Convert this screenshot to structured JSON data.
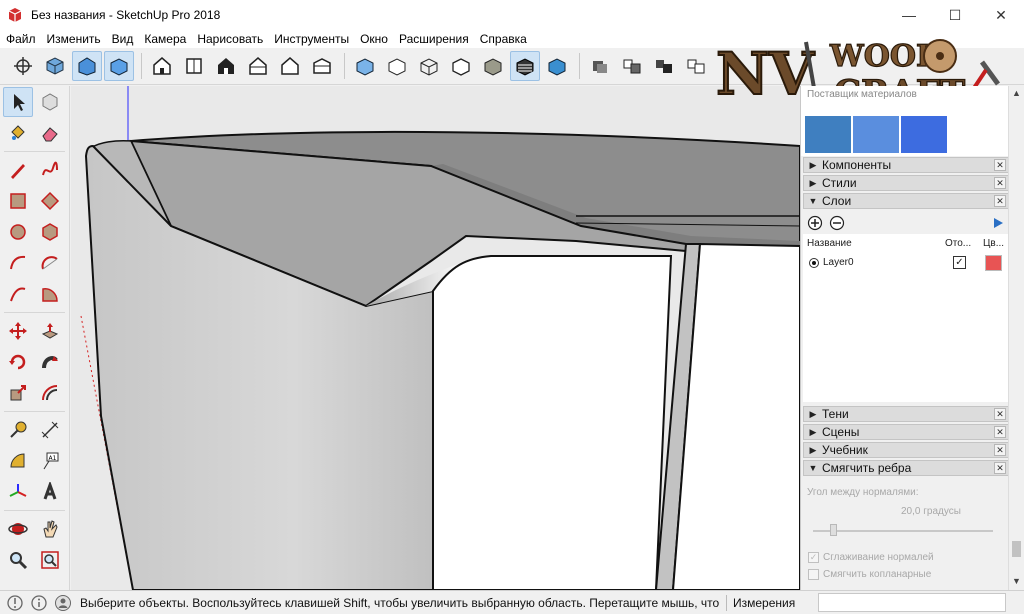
{
  "window": {
    "title": "Без названия - SketchUp Pro 2018",
    "minimize_glyph": "—",
    "maximize_glyph": "☐",
    "close_glyph": "✕"
  },
  "menu": [
    "Файл",
    "Изменить",
    "Вид",
    "Камера",
    "Нарисовать",
    "Инструменты",
    "Окно",
    "Расширения",
    "Справка"
  ],
  "logo": {
    "text": "NV WOOD CRAFT"
  },
  "tray": {
    "materials_title": "Поставщик материалов",
    "swatch_colors": [
      "#3f7fc0",
      "#5a8ede",
      "#3d6ce0"
    ],
    "panels_top": [
      {
        "label": "Компоненты",
        "expanded": false
      },
      {
        "label": "Стили",
        "expanded": false
      },
      {
        "label": "Слои",
        "expanded": true
      }
    ],
    "layers": {
      "col_name": "Название",
      "col_visible": "Ото...",
      "col_color": "Цв...",
      "rows": [
        {
          "name": "Layer0",
          "active": true,
          "visible": true,
          "color": "#e85454"
        }
      ]
    },
    "panels_bottom": [
      {
        "label": "Тени",
        "expanded": false
      },
      {
        "label": "Сцены",
        "expanded": false
      },
      {
        "label": "Учебник",
        "expanded": false
      },
      {
        "label": "Смягчить ребра",
        "expanded": true
      }
    ],
    "soften": {
      "angle_label": "Угол между нормалями:",
      "angle_value": "20,0 градусы",
      "slider_value_degrees": 20,
      "smooth_normals_label": "Сглаживание нормалей",
      "smooth_normals_checked": true,
      "soften_coplanar_label": "Смягчить копланарные",
      "soften_coplanar_checked": false
    }
  },
  "status": {
    "message": "Выберите объекты. Воспользуйтесь клавишей Shift, чтобы увеличить выбранную область. Перетащите мышь, чтобы выбрать несколько объектов.",
    "measure_label": "Измерения",
    "measure_value": ""
  },
  "colors": {
    "selection_active": "#cfe3f5",
    "axis_blue": "#2b2bff",
    "axis_red": "#d42020",
    "sketchup_red": "#c41e1e"
  }
}
